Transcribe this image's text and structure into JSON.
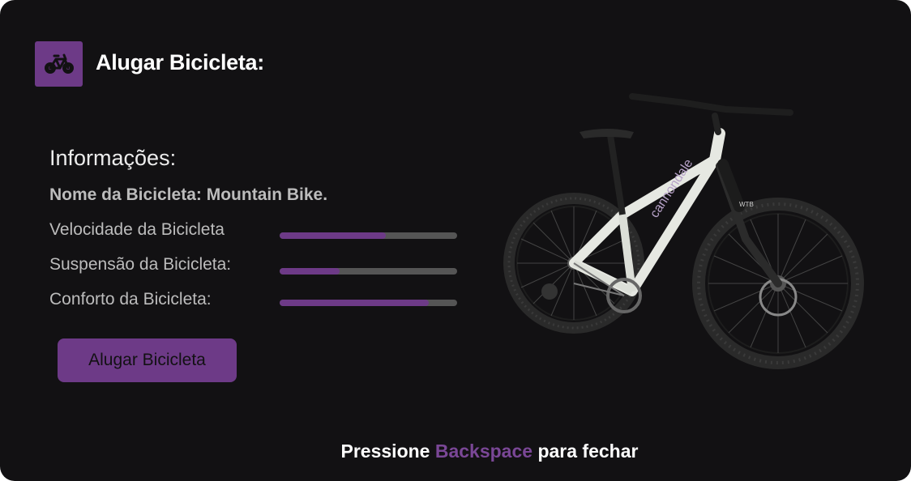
{
  "header": {
    "icon": "bicycle-icon",
    "title": "Alugar Bicicleta:"
  },
  "info": {
    "section_title": "Informações:",
    "bike_name": "Nome da Bicicleta: Mountain Bike.",
    "stats": [
      {
        "label": "Velocidade da Bicicleta",
        "value": 0.6
      },
      {
        "label": "Suspensão da Bicicleta:",
        "value": 0.34
      },
      {
        "label": "Conforto da Bicicleta:",
        "value": 0.84
      }
    ]
  },
  "rent_button": {
    "label": "Alugar Bicicleta"
  },
  "footer": {
    "prefix": "Pressione",
    "key": "Backspace",
    "suffix": "para fechar"
  },
  "image": {
    "subject": "white mountain bike",
    "brand_text": "cannondale",
    "tire_text": "WTB"
  },
  "colors": {
    "background": "#121113",
    "accent": "#6d3a87",
    "key_highlight": "#7a4796",
    "bar_track": "#555555",
    "muted_text": "#bcbcbc"
  }
}
